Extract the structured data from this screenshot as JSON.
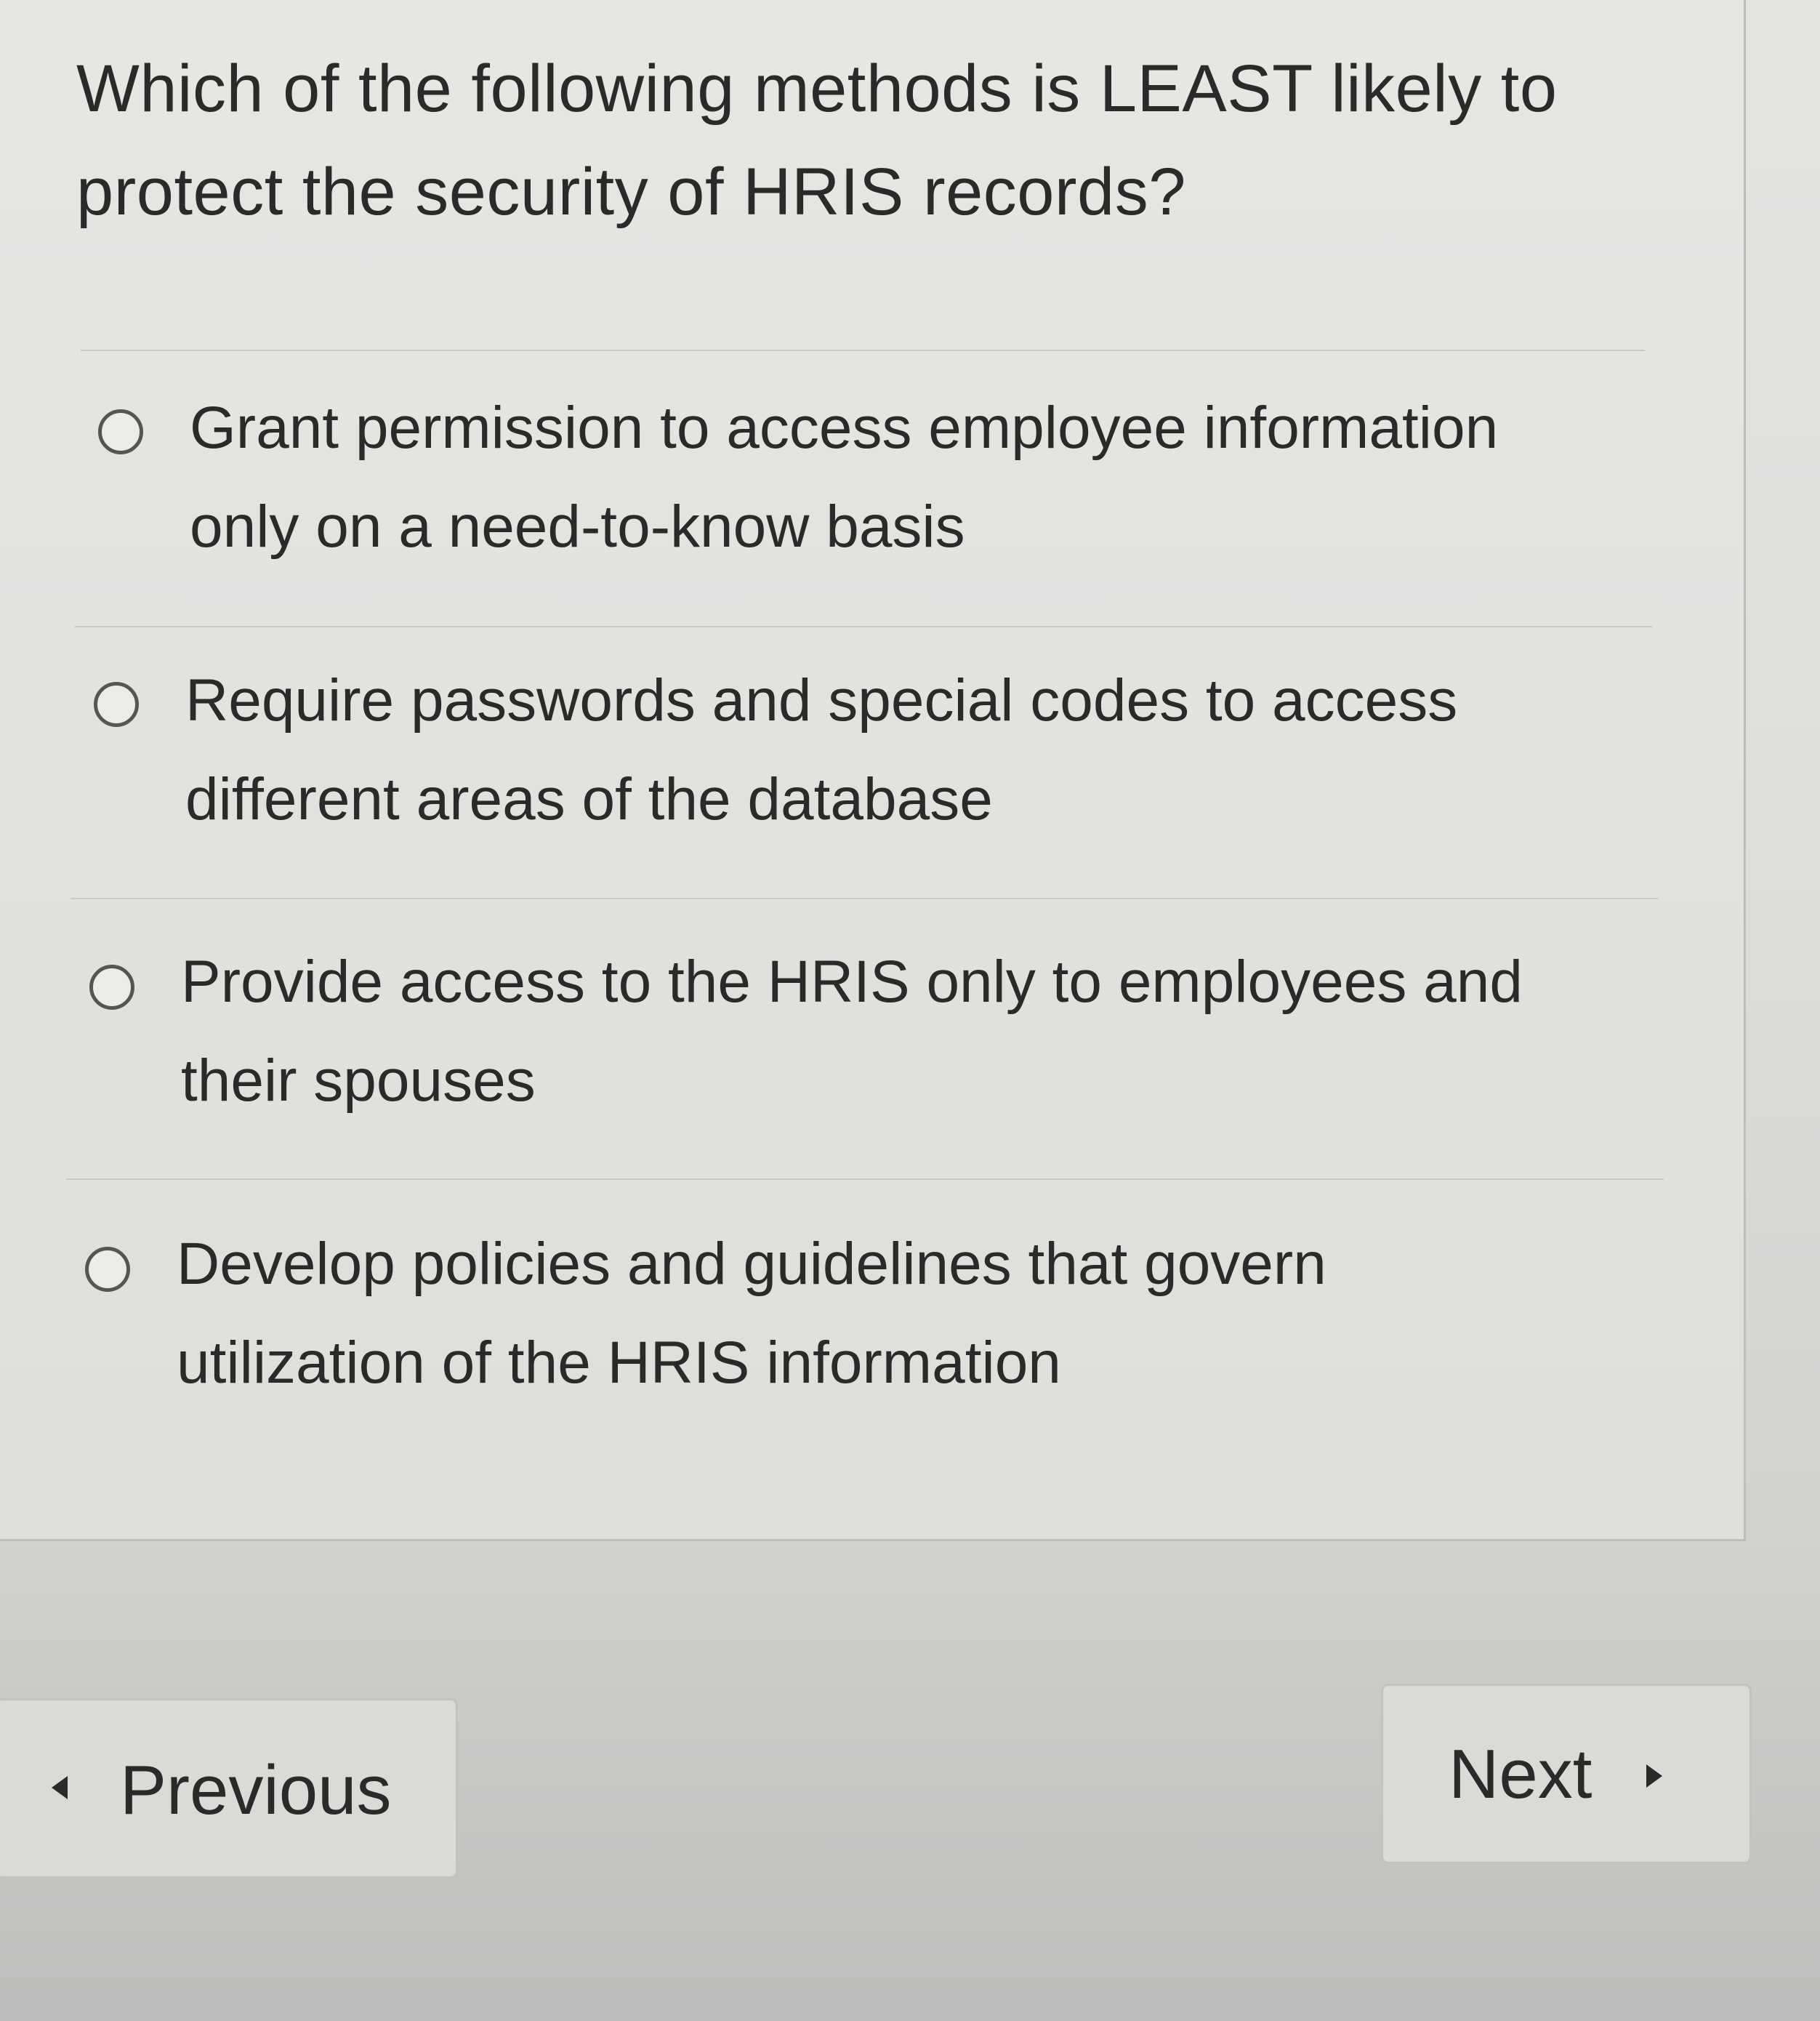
{
  "quiz": {
    "question": "Which of the following methods is LEAST likely to protect the security of HRIS records?",
    "question_line1": "Which of the following methods is LEAST likely to",
    "question_line2": "protect the security of HRIS records?",
    "options": [
      {
        "line1": "Grant permission to access employee information",
        "line2": "only on a need-to-know basis",
        "selected": false
      },
      {
        "line1": "Require passwords and special codes to access",
        "line2": "different areas of the database",
        "selected": false
      },
      {
        "line1": "Provide access to the HRIS only to employees and",
        "line2": "their spouses",
        "selected": false
      },
      {
        "line1": "Develop policies and guidelines that govern",
        "line2": "utilization of the HRIS information",
        "selected": false
      }
    ]
  },
  "navigation": {
    "previous_label": "Previous",
    "next_label": "Next",
    "previous_icon": "caret-left-icon",
    "next_icon": "caret-right-icon"
  },
  "colors": {
    "background": "#dedfdb",
    "text": "#2a2a2a",
    "radio_border": "#555555"
  }
}
